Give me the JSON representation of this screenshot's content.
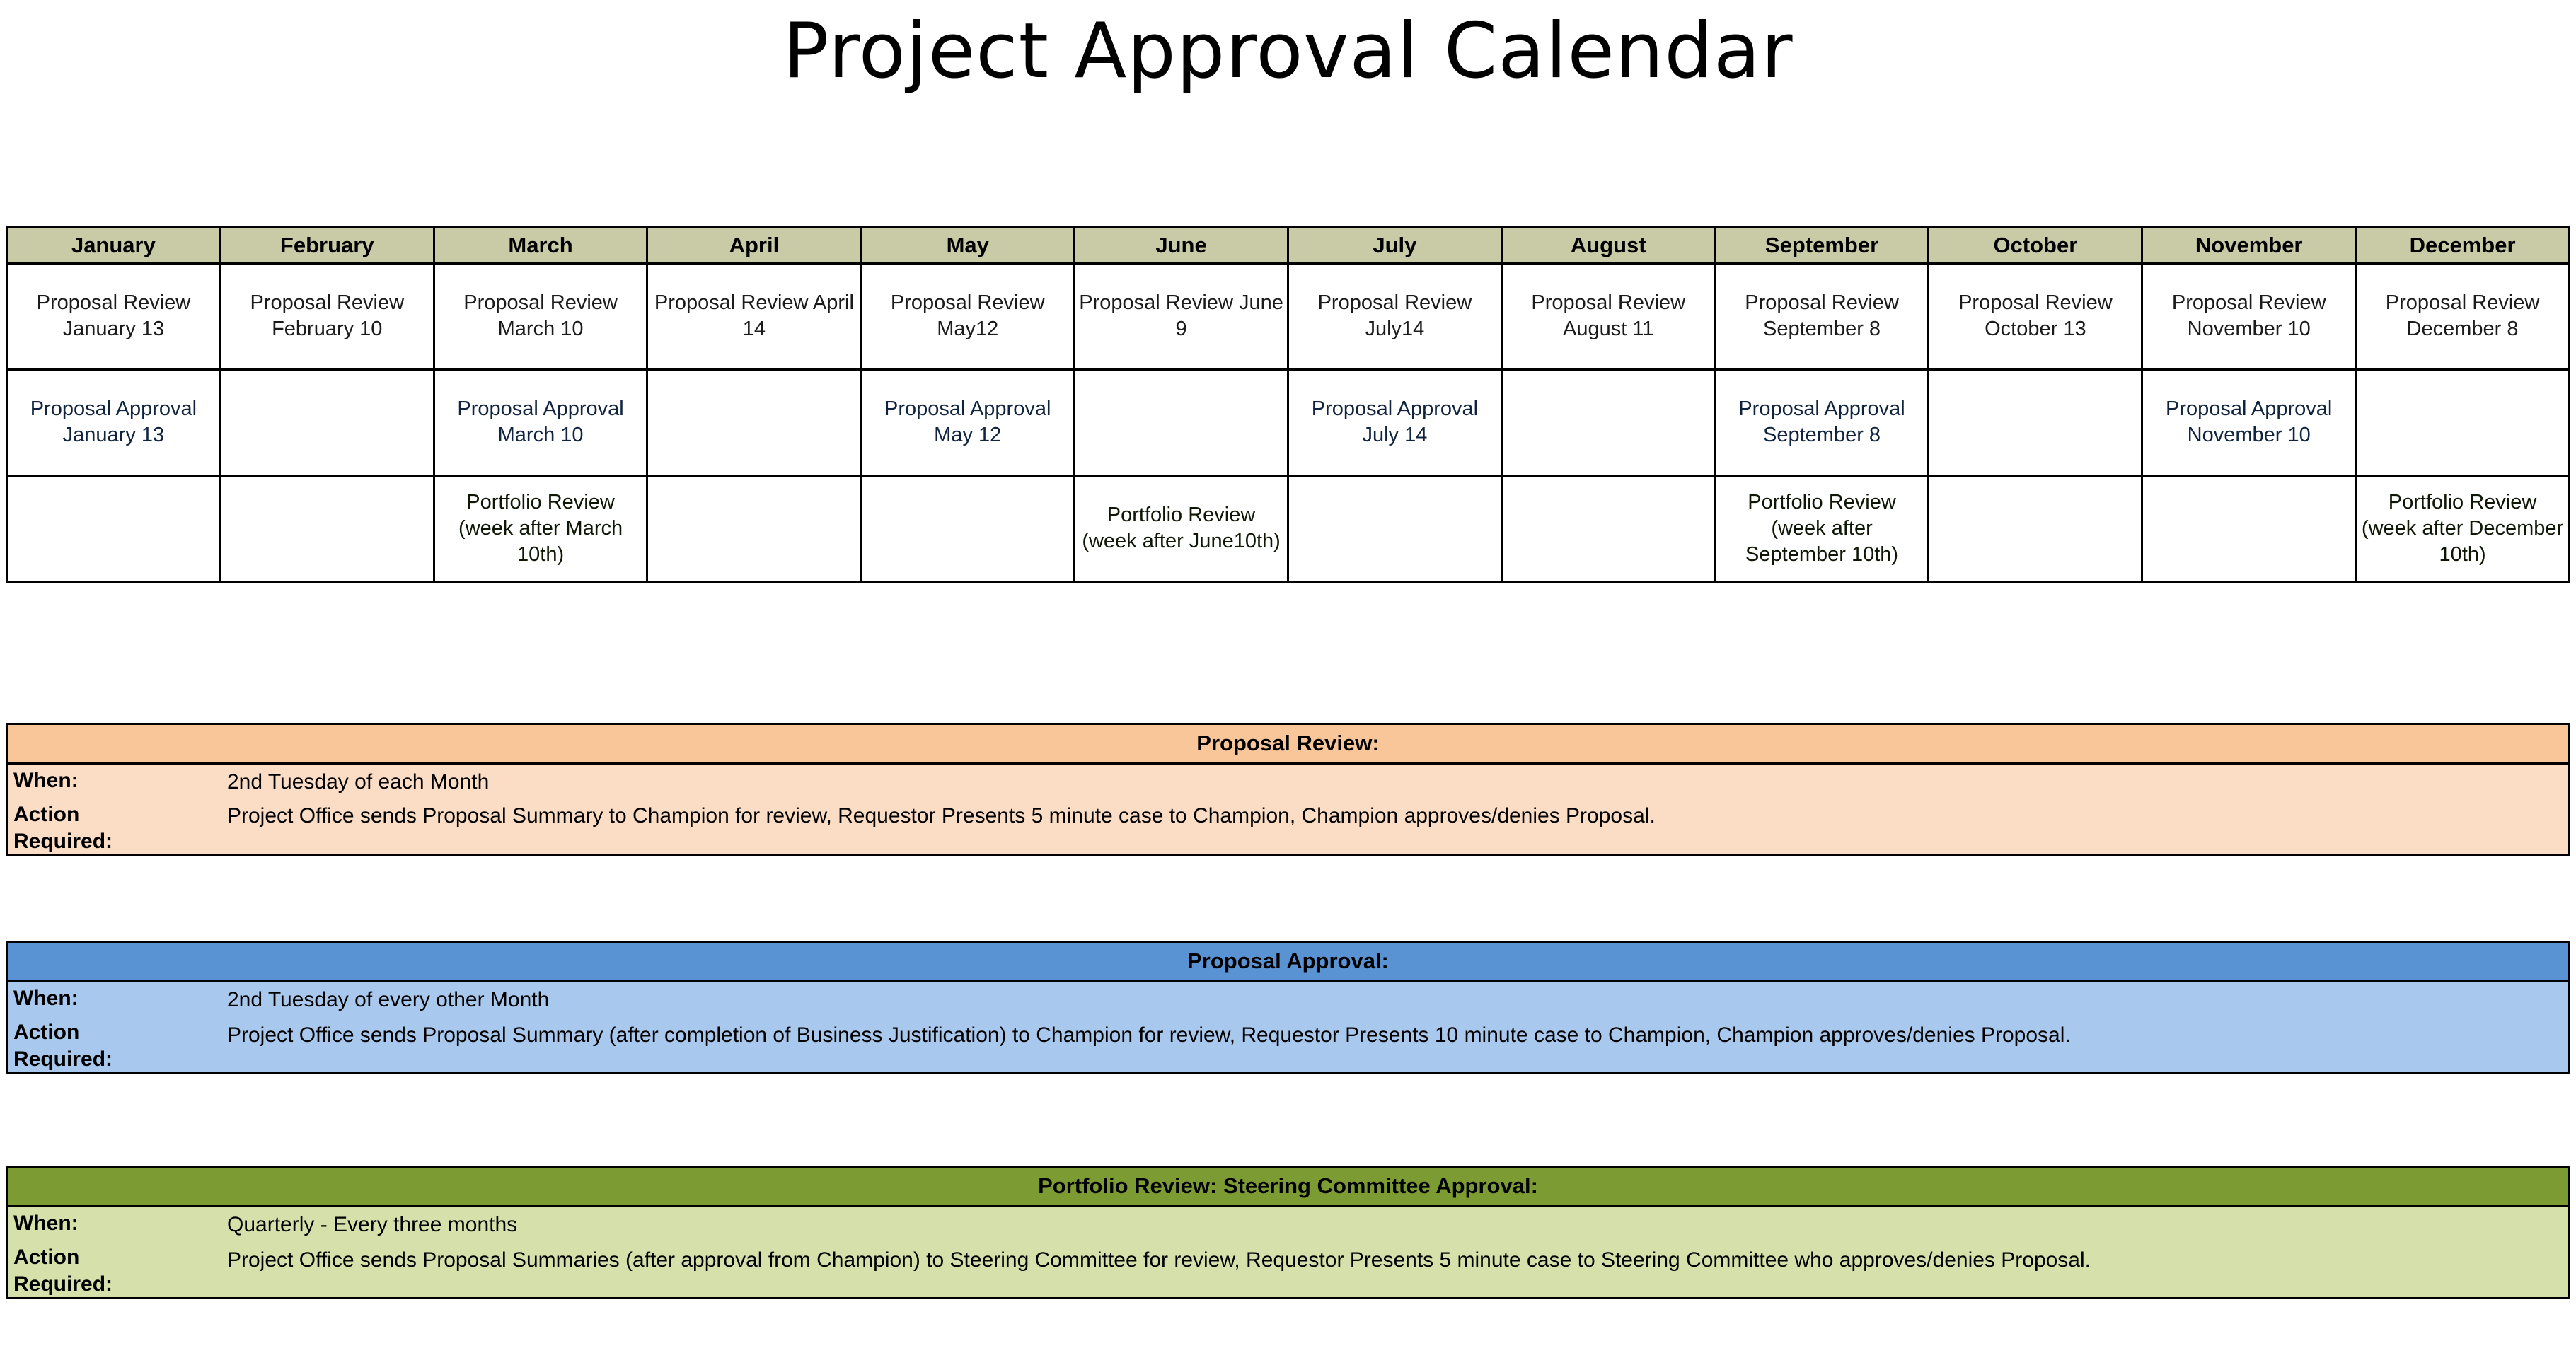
{
  "page": {
    "title": "Project Approval Calendar"
  },
  "calendar": {
    "months": [
      "January",
      "February",
      "March",
      "April",
      "May",
      "June",
      "July",
      "August",
      "September",
      "October",
      "November",
      "December"
    ],
    "rows": [
      {
        "name": "proposal-review",
        "type": "review",
        "cells": [
          "Proposal Review January 13",
          "Proposal Review February 10",
          "Proposal Review March 10",
          "Proposal Review April 14",
          "Proposal Review May12",
          "Proposal Review June 9",
          "Proposal Review July14",
          "Proposal Review August 11",
          "Proposal Review September 8",
          "Proposal Review October 13",
          "Proposal Review November 10",
          "Proposal Review December 8"
        ]
      },
      {
        "name": "proposal-approval",
        "type": "approval",
        "cells": [
          "Proposal Approval January 13",
          "",
          "Proposal Approval March 10",
          "",
          "Proposal Approval May 12",
          "",
          "Proposal Approval July 14",
          "",
          "Proposal Approval September 8",
          "",
          "Proposal Approval November 10",
          ""
        ]
      },
      {
        "name": "portfolio-review",
        "type": "portfolio",
        "cells": [
          "",
          "",
          "Portfolio Review (week after March 10th)",
          "",
          "",
          "Portfolio Review (week after June10th)",
          "",
          "",
          "Portfolio Review (week after September 10th)",
          "",
          "",
          "Portfolio Review (week after December 10th)"
        ]
      }
    ]
  },
  "legends": {
    "review": {
      "heading": "Proposal Review:",
      "when_label": "When:",
      "when_value": "2nd Tuesday of each Month",
      "action_label": "Action\nRequired:",
      "action_value": "Project Office sends Proposal Summary to Champion for review, Requestor Presents 5 minute case to Champion, Champion approves/denies Proposal."
    },
    "approval": {
      "heading": "Proposal Approval:",
      "when_label": "When:",
      "when_value": "2nd Tuesday of every other Month",
      "action_label": "Action\nRequired:",
      "action_value": "Project Office sends Proposal Summary (after completion of Business Justification) to Champion for review, Requestor Presents 10 minute case to Champion, Champion approves/denies Proposal."
    },
    "portfolio": {
      "heading": "Portfolio Review: Steering Committee Approval:",
      "when_label": "When:",
      "when_value": "Quarterly - Every three months",
      "action_label": "Action\nRequired:",
      "action_value": "Project Office sends Proposal Summaries (after approval from Champion) to Steering Committee for review, Requestor Presents 5 minute case to Steering Committee who approves/denies Proposal."
    }
  },
  "colors": {
    "review_header": "#f9c69a",
    "review_body": "#fbdcc4",
    "approval_header": "#5a93d4",
    "approval_body": "#a9c8ee",
    "portfolio_header": "#7d9b33",
    "portfolio_body": "#d5e0ab",
    "month_header": "#c9caa6",
    "border": "#000000"
  }
}
